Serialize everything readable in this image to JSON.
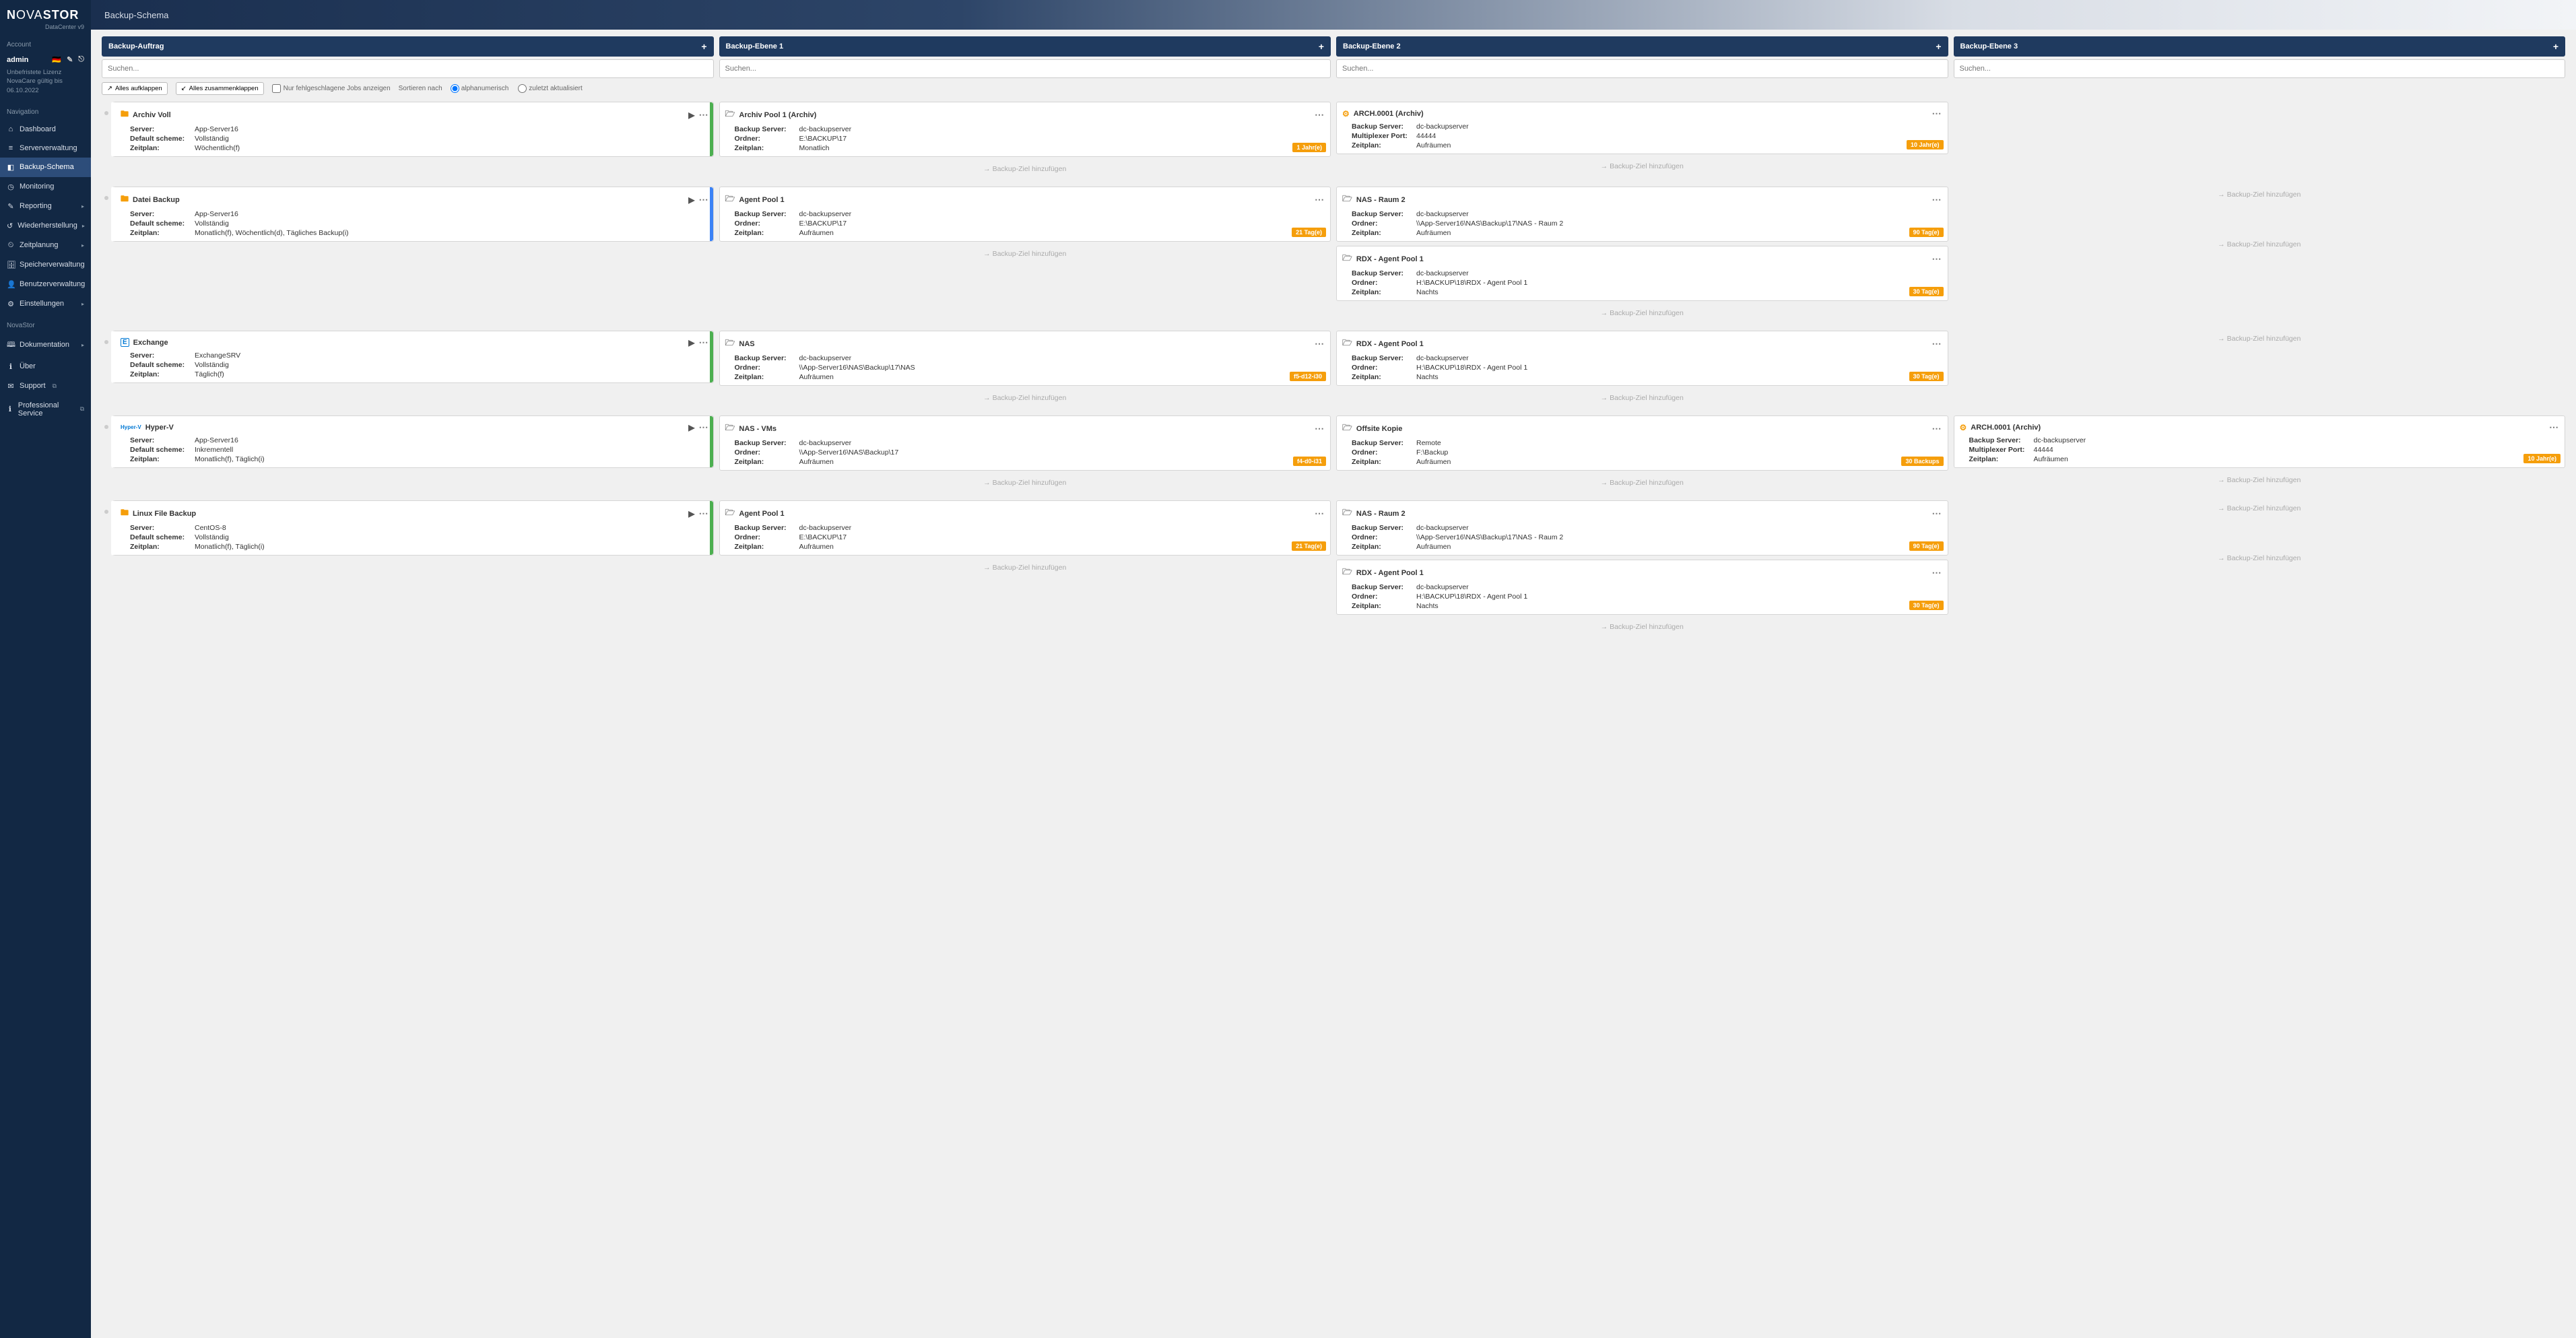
{
  "brand": {
    "name_prefix": "N",
    "name_mid": "OVA",
    "name_suffix": "STOR",
    "subtitle": "DataCenter v9"
  },
  "page_title": "Backup-Schema",
  "account": {
    "section": "Account",
    "user": "admin",
    "license_line1": "Unbefristete Lizenz",
    "license_line2": "NovaCare gültig bis 06.10.2022"
  },
  "nav": {
    "section": "Navigation",
    "items": [
      {
        "icon": "⌂",
        "label": "Dashboard"
      },
      {
        "icon": "≡",
        "label": "Serververwaltung"
      },
      {
        "icon": "◧",
        "label": "Backup-Schema",
        "active": true
      },
      {
        "icon": "◷",
        "label": "Monitoring"
      },
      {
        "icon": "✎",
        "label": "Reporting",
        "caret": true
      },
      {
        "icon": "↺",
        "label": "Wiederherstellung",
        "caret": true
      },
      {
        "icon": "⏲",
        "label": "Zeitplanung",
        "caret": true
      },
      {
        "icon": "🗄",
        "label": "Speicherverwaltung"
      },
      {
        "icon": "👤",
        "label": "Benutzerverwaltung"
      },
      {
        "icon": "⚙",
        "label": "Einstellungen",
        "caret": true
      }
    ]
  },
  "novastor_section": {
    "section": "NovaStor",
    "items": [
      {
        "icon": "🕮",
        "label": "Dokumentation",
        "caret": true
      },
      {
        "icon": "ℹ",
        "label": "Über"
      },
      {
        "icon": "✉",
        "label": "Support",
        "ext": true
      },
      {
        "icon": "ℹ",
        "label": "Professional Service",
        "ext": true
      }
    ]
  },
  "columns": [
    {
      "title": "Backup-Auftrag",
      "search_ph": "Suchen..."
    },
    {
      "title": "Backup-Ebene 1",
      "search_ph": "Suchen..."
    },
    {
      "title": "Backup-Ebene 2",
      "search_ph": "Suchen..."
    },
    {
      "title": "Backup-Ebene 3",
      "search_ph": "Suchen..."
    }
  ],
  "toolbar": {
    "expand": "Alles aufklappen",
    "collapse": "Alles zusammenklappen",
    "only_failed": "Nur fehlgeschlagene Jobs anzeigen",
    "sort_label": "Sortieren nach",
    "radio_alpha": "alphanumerisch",
    "radio_updated": "zuletzt aktualisiert"
  },
  "labels": {
    "server": "Server:",
    "default_scheme": "Default scheme:",
    "zeitplan": "Zeitplan:",
    "backup_server": "Backup Server:",
    "ordner": "Ordner:",
    "multiplexer_port": "Multiplexer Port:",
    "add_target": "Backup-Ziel hinzufügen"
  },
  "rows": [
    {
      "job": {
        "icon": "folder",
        "color": "green",
        "title": "Archiv Voll",
        "server": "App-Server16",
        "scheme": "Vollständig",
        "plan": "Wöchentlich(f)"
      },
      "l1": [
        {
          "icon": "folder-gray",
          "title": "Archiv Pool 1 (Archiv)",
          "bs": "dc-backupserver",
          "folder": "E:\\BACKUP\\17",
          "plan": "Monatlich",
          "badge": "1 Jahr(e)"
        }
      ],
      "l2": [
        {
          "icon": "gear",
          "title": "ARCH.0001 (Archiv)",
          "bs": "dc-backupserver",
          "mport": "44444",
          "plan": "Aufräumen",
          "badge": "10 Jahr(e)"
        }
      ],
      "l3": []
    },
    {
      "job": {
        "icon": "folder",
        "color": "blue",
        "title": "Datei Backup",
        "server": "App-Server16",
        "scheme": "Vollständig",
        "plan": "Monatlich(f), Wöchentlich(d), Tägliches Backup(i)"
      },
      "l1": [
        {
          "icon": "folder-gray",
          "title": "Agent Pool 1",
          "bs": "dc-backupserver",
          "folder": "E:\\BACKUP\\17",
          "plan": "Aufräumen",
          "badge": "21 Tag(e)"
        }
      ],
      "l2": [
        {
          "icon": "folder-gray",
          "title": "NAS - Raum 2",
          "bs": "dc-backupserver",
          "folder": "\\\\App-Server16\\NAS\\Backup\\17\\NAS - Raum 2",
          "plan": "Aufräumen",
          "badge": "90 Tag(e)"
        },
        {
          "icon": "folder-gray",
          "title": "RDX - Agent Pool 1",
          "bs": "dc-backupserver",
          "folder": "H:\\BACKUP\\18\\RDX - Agent Pool 1",
          "plan": "Nachts",
          "badge": "30 Tag(e)"
        }
      ],
      "l3": [
        {
          "add_only": true
        },
        {
          "add_only": true
        }
      ]
    },
    {
      "job": {
        "icon": "ex",
        "color": "green",
        "title": "Exchange",
        "server": "ExchangeSRV",
        "scheme": "Vollständig",
        "plan": "Täglich(f)"
      },
      "l1": [
        {
          "icon": "folder-gray",
          "title": "NAS",
          "bs": "dc-backupserver",
          "folder": "\\\\App-Server16\\NAS\\Backup\\17\\NAS",
          "plan": "Aufräumen",
          "badge": "f5-d12-i30"
        }
      ],
      "l2": [
        {
          "icon": "folder-gray",
          "title": "RDX - Agent Pool 1",
          "bs": "dc-backupserver",
          "folder": "H:\\BACKUP\\18\\RDX - Agent Pool 1",
          "plan": "Nachts",
          "badge": "30 Tag(e)"
        }
      ],
      "l3": [
        {
          "add_only": true
        }
      ]
    },
    {
      "job": {
        "icon": "hv",
        "color": "green",
        "title": "Hyper-V",
        "server": "App-Server16",
        "scheme": "Inkrementell",
        "plan": "Monatlich(f), Täglich(i)"
      },
      "l1": [
        {
          "icon": "folder-gray",
          "title": "NAS - VMs",
          "bs": "dc-backupserver",
          "folder": "\\\\App-Server16\\NAS\\Backup\\17",
          "plan": "Aufräumen",
          "badge": "f4-d0-i31"
        }
      ],
      "l2": [
        {
          "icon": "folder-gray",
          "title": "Offsite Kopie",
          "bs": "Remote",
          "folder": "F:\\Backup",
          "plan": "Aufräumen",
          "badge": "30 Backups"
        }
      ],
      "l3": [
        {
          "icon": "gear",
          "title": "ARCH.0001 (Archiv)",
          "bs": "dc-backupserver",
          "mport": "44444",
          "plan": "Aufräumen",
          "badge": "10 Jahr(e)"
        }
      ]
    },
    {
      "job": {
        "icon": "folder",
        "color": "green",
        "title": "Linux File Backup",
        "server": "CentOS-8",
        "scheme": "Vollständig",
        "plan": "Monatlich(f), Täglich(i)"
      },
      "l1": [
        {
          "icon": "folder-gray",
          "title": "Agent Pool 1",
          "bs": "dc-backupserver",
          "folder": "E:\\BACKUP\\17",
          "plan": "Aufräumen",
          "badge": "21 Tag(e)"
        }
      ],
      "l2": [
        {
          "icon": "folder-gray",
          "title": "NAS - Raum 2",
          "bs": "dc-backupserver",
          "folder": "\\\\App-Server16\\NAS\\Backup\\17\\NAS - Raum 2",
          "plan": "Aufräumen",
          "badge": "90 Tag(e)"
        },
        {
          "icon": "folder-gray",
          "title": "RDX - Agent Pool 1",
          "bs": "dc-backupserver",
          "folder": "H:\\BACKUP\\18\\RDX - Agent Pool 1",
          "plan": "Nachts",
          "badge": "30 Tag(e)"
        }
      ],
      "l3": [
        {
          "add_only": true
        },
        {
          "add_only": true
        }
      ]
    }
  ]
}
